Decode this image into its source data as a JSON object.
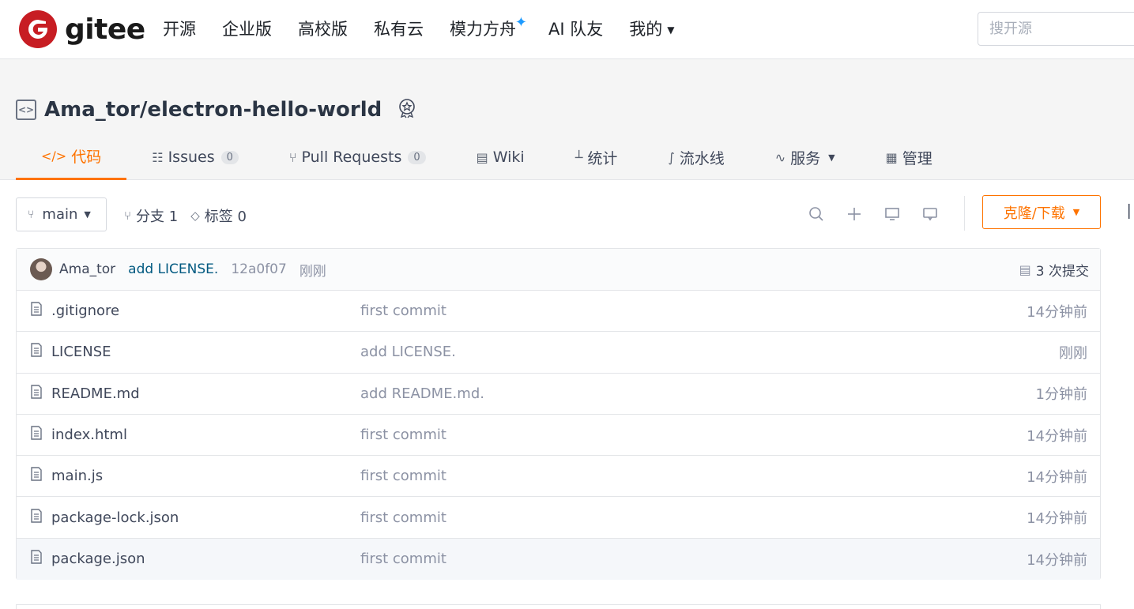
{
  "brand": {
    "name": "gitee",
    "color": "#c71d23"
  },
  "nav": {
    "items": [
      "开源",
      "企业版",
      "高校版",
      "私有云",
      "模力方舟",
      "AI 队友",
      "我的"
    ],
    "search_placeholder": "搜开源"
  },
  "repo": {
    "full_name": "Ama_tor/electron-hello-world",
    "tabs": [
      {
        "label": "代码",
        "icon": "code-icon",
        "count": null,
        "active": true
      },
      {
        "label": "Issues",
        "icon": "issues-icon",
        "count": "0"
      },
      {
        "label": "Pull Requests",
        "icon": "pull-request-icon",
        "count": "0"
      },
      {
        "label": "Wiki",
        "icon": "wiki-icon",
        "count": null
      },
      {
        "label": "统计",
        "icon": "stats-icon",
        "count": null
      },
      {
        "label": "流水线",
        "icon": "pipeline-icon",
        "count": null
      },
      {
        "label": "服务",
        "icon": "service-icon",
        "count": null
      },
      {
        "label": "管理",
        "icon": "manage-icon",
        "count": null
      }
    ]
  },
  "toolbar": {
    "branch": "main",
    "branches_label": "分支 1",
    "tags_label": "标签 0",
    "clone_label": "克隆/下载"
  },
  "last_commit": {
    "author": "Ama_tor",
    "message": "add LICENSE.",
    "hash": "12a0f07",
    "time": "刚刚",
    "count_label": "3 次提交"
  },
  "files": [
    {
      "name": ".gitignore",
      "message": "first commit",
      "time": "14分钟前"
    },
    {
      "name": "LICENSE",
      "message": "add LICENSE.",
      "time": "刚刚"
    },
    {
      "name": "README.md",
      "message": "add README.md.",
      "time": "1分钟前"
    },
    {
      "name": "index.html",
      "message": "first commit",
      "time": "14分钟前"
    },
    {
      "name": "main.js",
      "message": "first commit",
      "time": "14分钟前"
    },
    {
      "name": "package-lock.json",
      "message": "first commit",
      "time": "14分钟前"
    },
    {
      "name": "package.json",
      "message": "first commit",
      "time": "14分钟前"
    }
  ],
  "accent_color": "#fe7300"
}
